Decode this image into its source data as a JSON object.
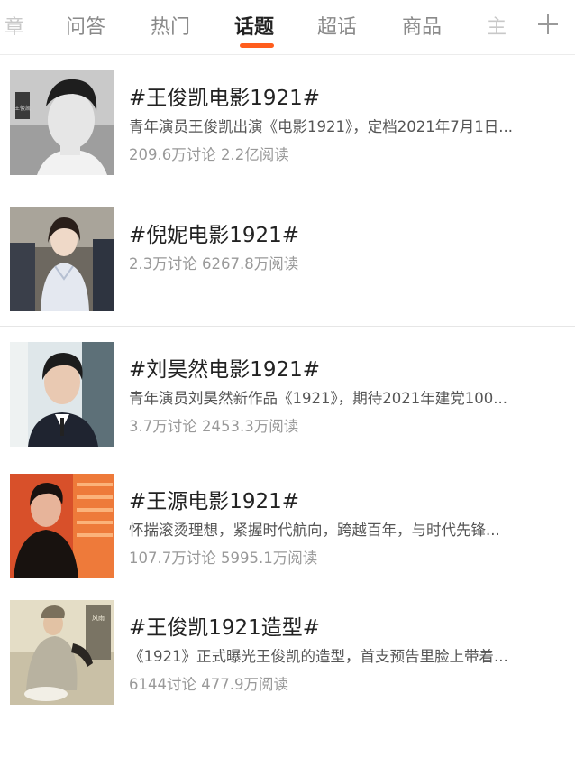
{
  "tabs": [
    {
      "label": "章"
    },
    {
      "label": "问答"
    },
    {
      "label": "热门"
    },
    {
      "label": "话题"
    },
    {
      "label": "超话"
    },
    {
      "label": "商品"
    },
    {
      "label": "主"
    }
  ],
  "active_tab": "话题",
  "plus_icon": "plus-icon",
  "accent_color": "#ff5d1d",
  "topics": [
    {
      "title": "#王俊凯电影1921#",
      "desc": "青年演员王俊凯出演《电影1921》，定档2021年7月1日...",
      "stats": "209.6万讨论 2.2亿阅读",
      "thumb_text": "王俊凯"
    },
    {
      "title": "#倪妮电影1921#",
      "desc": "",
      "stats": "2.3万讨论 6267.8万阅读"
    },
    {
      "title": "#刘昊然电影1921#",
      "desc": "青年演员刘昊然新作品《1921》，期待2021年建党100...",
      "stats": "3.7万讨论 2453.3万阅读"
    },
    {
      "title": "#王源电影1921#",
      "desc": "怀揣滚烫理想，紧握时代航向，跨越百年，与时代先锋...",
      "stats": "107.7万讨论 5995.1万阅读"
    },
    {
      "title": "#王俊凯1921造型#",
      "desc": "《1921》正式曝光王俊凯的造型，首支预告里脸上带着...",
      "stats": "6144讨论 477.9万阅读",
      "thumb_text": "风雨"
    }
  ]
}
